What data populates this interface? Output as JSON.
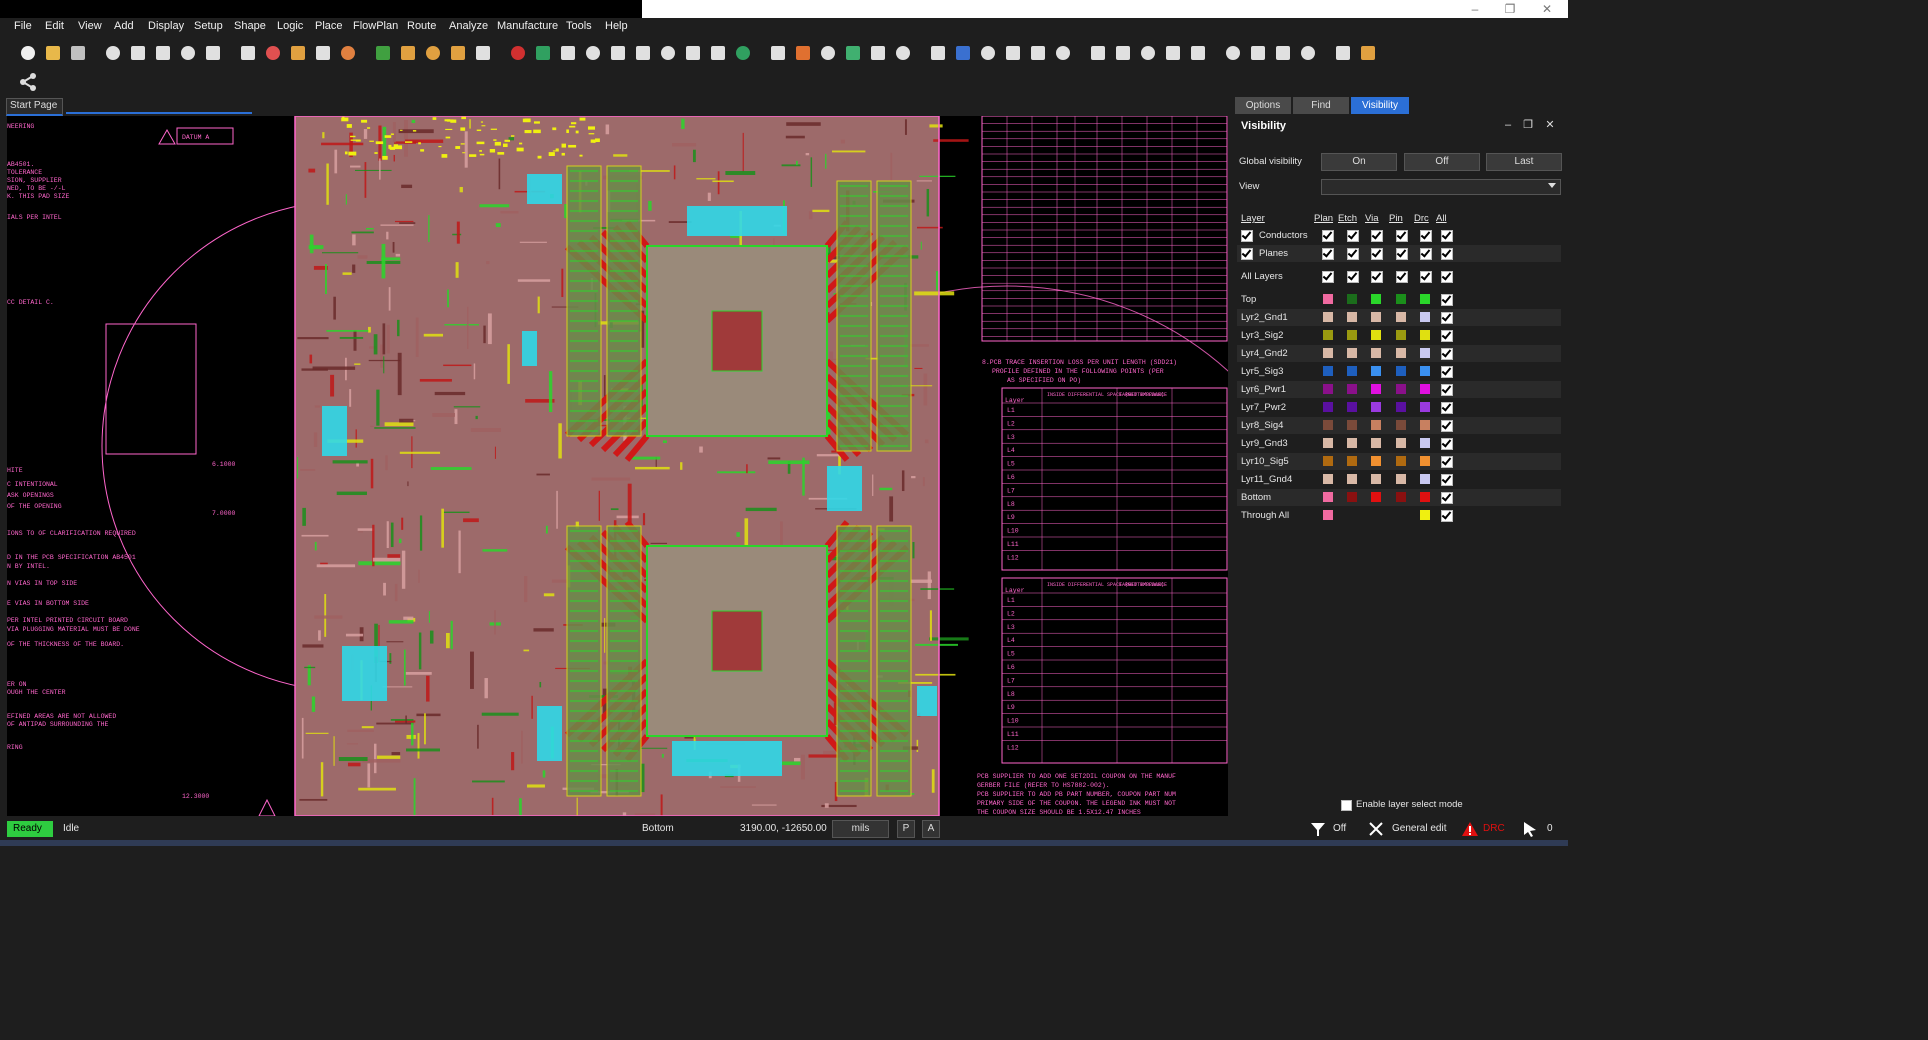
{
  "window": {
    "minimize_glyph": "–",
    "maximize_glyph": "❐",
    "close_glyph": "✕"
  },
  "menu": [
    "File",
    "Edit",
    "View",
    "Add",
    "Display",
    "Setup",
    "Shape",
    "Logic",
    "Place",
    "FlowPlan",
    "Route",
    "Analyze",
    "Manufacture",
    "Tools",
    "Help"
  ],
  "tabs": {
    "start_page": "Start Page"
  },
  "panel": {
    "tabs": [
      "Options",
      "Find",
      "Visibility"
    ],
    "active_tab": "Visibility",
    "title": "Visibility",
    "global_visibility_label": "Global visibility",
    "global_buttons": [
      "On",
      "Off",
      "Last"
    ],
    "view_label": "View",
    "view_value": "",
    "columns": {
      "layer": "Layer",
      "plan": "Plan",
      "etch": "Etch",
      "via": "Via",
      "pin": "Pin",
      "drc": "Drc",
      "all": "All"
    },
    "groups": [
      {
        "name": "Conductors",
        "checked": true
      },
      {
        "name": "Planes",
        "checked": true
      }
    ],
    "all_layers_label": "All Layers",
    "layers": [
      {
        "name": "Top",
        "plan": "#f06aa0",
        "colors": [
          "#1b6d1b",
          "#2ad62a",
          "#1b8f1b",
          "#2ad62a"
        ]
      },
      {
        "name": "Lyr2_Gnd1",
        "plan": "#d8b8a6",
        "colors": [
          "#d8b8a6",
          "#d8b8a6",
          "#d8b8a6",
          "#c8c8f0"
        ]
      },
      {
        "name": "Lyr3_Sig2",
        "plan": "#9a9a10",
        "colors": [
          "#9a9a10",
          "#e0e010",
          "#9a9a10",
          "#e0e010"
        ]
      },
      {
        "name": "Lyr4_Gnd2",
        "plan": "#d8b8a6",
        "colors": [
          "#d8b8a6",
          "#d8b8a6",
          "#d8b8a6",
          "#c8c8f0"
        ]
      },
      {
        "name": "Lyr5_Sig3",
        "plan": "#1e5fbe",
        "colors": [
          "#1e5fbe",
          "#3a90f0",
          "#1e5fbe",
          "#3a90f0"
        ]
      },
      {
        "name": "Lyr6_Pwr1",
        "plan": "#8a108a",
        "colors": [
          "#8a108a",
          "#e010e0",
          "#8a108a",
          "#e010e0"
        ]
      },
      {
        "name": "Lyr7_Pwr2",
        "plan": "#5a10a0",
        "colors": [
          "#5a10a0",
          "#9a3ae0",
          "#5a10a0",
          "#9a3ae0"
        ]
      },
      {
        "name": "Lyr8_Sig4",
        "plan": "#7a4a3a",
        "colors": [
          "#7a4a3a",
          "#c88060",
          "#7a4a3a",
          "#c88060"
        ]
      },
      {
        "name": "Lyr9_Gnd3",
        "plan": "#d8b8a6",
        "colors": [
          "#d8b8a6",
          "#d8b8a6",
          "#d8b8a6",
          "#c8c8f0"
        ]
      },
      {
        "name": "Lyr10_Sig5",
        "plan": "#b06a10",
        "colors": [
          "#b06a10",
          "#f09030",
          "#b06a10",
          "#f09030"
        ]
      },
      {
        "name": "Lyr11_Gnd4",
        "plan": "#d8b8a6",
        "colors": [
          "#d8b8a6",
          "#d8b8a6",
          "#d8b8a6",
          "#c8c8f0"
        ]
      },
      {
        "name": "Bottom",
        "plan": "#f06aa0",
        "colors": [
          "#8a1010",
          "#e01010",
          "#8a1010",
          "#e01010"
        ]
      },
      {
        "name": "Through All",
        "plan": "#f06aa0",
        "colors": [
          "",
          "",
          "",
          "#f0f010"
        ]
      }
    ],
    "layer_select_label": "Enable layer select mode"
  },
  "canvas": {
    "left_notes": [
      "NEERING",
      "AB4501.",
      "TOLERANCE",
      "SION, SUPPLIER",
      "NED, TO BE -/-L",
      "K. THIS PAD SIZE",
      "IALS PER INTEL",
      "CC DETAIL C.",
      "HITE",
      "C INTENTIONAL",
      "ASK OPENINGS",
      "OF THE OPENING",
      "IONS TO OF CLARIFICATION REQUIRED",
      "D IN THE PCB SPECIFICATION AB4501",
      "N BY INTEL.",
      "N VIAS IN TOP SIDE",
      "E VIAS IN BOTTOM SIDE",
      "PER INTEL PRINTED CIRCUIT BOARD",
      "VIA PLUGGING MATERIAL MUST BE DONE",
      "OF THE THICKNESS OF THE BOARD.",
      "ER ON",
      "OUGH THE CENTER",
      "EFINED AREAS ARE NOT ALLOWED",
      "OF ANTIPAD SURROUNDING THE",
      "RING"
    ],
    "datum_label": "DATUM A",
    "dims": [
      "6.1000",
      "7.0000",
      "12.3000"
    ],
    "note8_lines": [
      "8.PCB TRACE INSERTION LOSS PER UNIT LENGTH (SDD21)",
      "PROFILE DEFINED IN THE FOLLOWING POINTS (PER",
      "AS SPECIFIED ON PO)"
    ],
    "bottom_notes": [
      "PCB SUPPLIER TO ADD ONE SET2DIL COUPON ON THE MANUF",
      "GERBER FILE (REFER TO HS7882-002).",
      "PCB SUPPLIER TO ADD PB PART NUMBER, COUPON PART NUM",
      "PRIMARY SIDE OF THE COUPON. THE LEGEND INK MUST NOT",
      "THE COUPON SIZE SHOULD BE 1.5X12.47 INCHES"
    ],
    "table1_rows": [
      "L1",
      "L2",
      "L3",
      "L4",
      "L5",
      "L6",
      "L7",
      "L8",
      "L9",
      "L10",
      "L11",
      "L12"
    ],
    "table_header": [
      "Layer",
      "INSIDE DIFFERENTIAL SPACE (WIDTH/SPACE)",
      "TARGET IMPEDANCE"
    ]
  },
  "status": {
    "state": "Ready",
    "mode": "Idle",
    "active_layer": "Bottom",
    "coords": "3190.00, -12650.00",
    "units": "mils",
    "btn_p": "P",
    "btn_a": "A",
    "filter_state": "Off",
    "edit_mode": "General edit",
    "drc_label": "DRC",
    "count": "0"
  },
  "colors": {
    "accent": "#2b6fd6",
    "ready": "#2ecc40",
    "drc": "#e01010",
    "outline": "#ff66cc"
  }
}
